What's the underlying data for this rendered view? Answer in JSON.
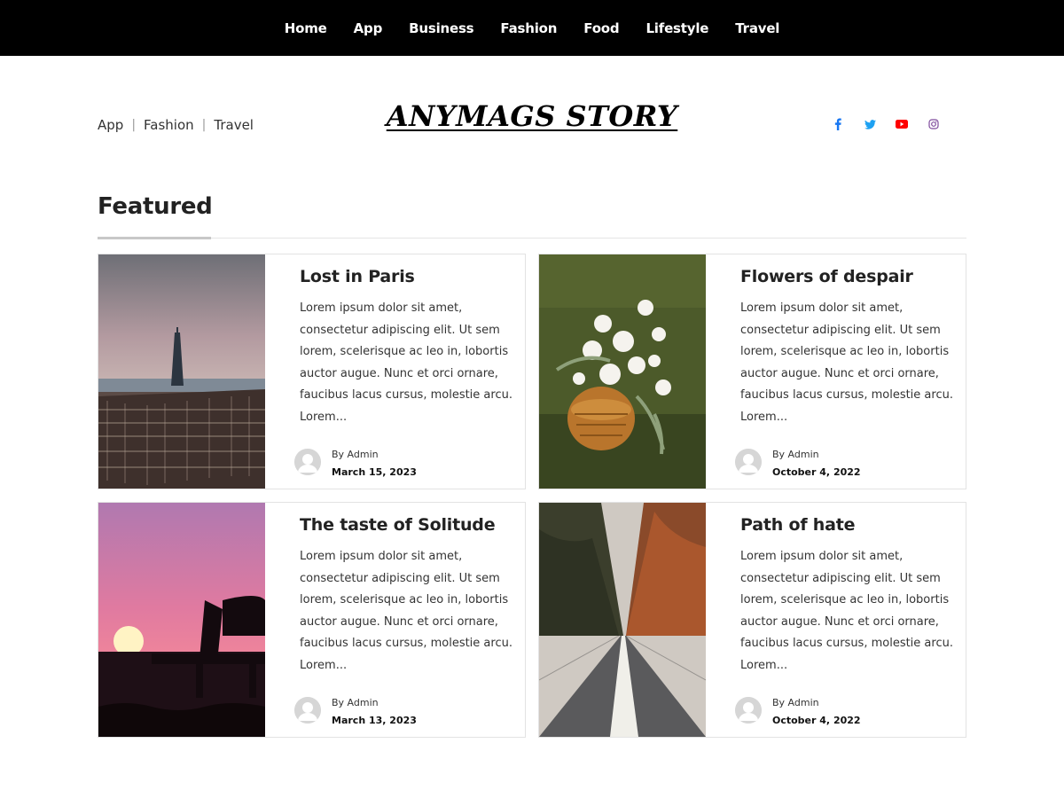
{
  "topnav": {
    "items": [
      "Home",
      "App",
      "Business",
      "Fashion",
      "Food",
      "Lifestyle",
      "Travel"
    ]
  },
  "header": {
    "categories": [
      "App",
      "Fashion",
      "Travel"
    ],
    "logo": "ANYMAGS STORY",
    "social_icons": [
      {
        "name": "facebook-icon",
        "color": "#1877f2"
      },
      {
        "name": "twitter-icon",
        "color": "#1da1f2"
      },
      {
        "name": "youtube-icon",
        "color": "#ff0000"
      },
      {
        "name": "instagram-icon",
        "color": "#7e4a9c"
      }
    ]
  },
  "section": {
    "title": "Featured"
  },
  "posts": [
    {
      "title": "Lost in Paris",
      "excerpt": "Lorem ipsum dolor sit amet, consectetur adipiscing elit. Ut sem lorem, scelerisque ac leo in, lobortis auctor augue. Nunc et orci ornare, faucibus lacus cursus, molestie arcu. Lorem...",
      "author": "By Admin",
      "date": "March 15, 2023",
      "image": "paris-cityscape"
    },
    {
      "title": "Flowers of despair",
      "excerpt": "Lorem ipsum dolor sit amet, consectetur adipiscing elit. Ut sem lorem, scelerisque ac leo in, lobortis auctor augue. Nunc et orci ornare, faucibus lacus cursus, molestie arcu. Lorem...",
      "author": "By Admin",
      "date": "October 4, 2022",
      "image": "flower-basket"
    },
    {
      "title": "The taste of Solitude",
      "excerpt": "Lorem ipsum dolor sit amet, consectetur adipiscing elit. Ut sem lorem, scelerisque ac leo in, lobortis auctor augue. Nunc et orci ornare, faucibus lacus cursus, molestie arcu. Lorem...",
      "author": "By Admin",
      "date": "March 13, 2023",
      "image": "sunset-bench"
    },
    {
      "title": "Path of hate",
      "excerpt": "Lorem ipsum dolor sit amet, consectetur adipiscing elit. Ut sem lorem, scelerisque ac leo in, lobortis auctor augue. Nunc et orci ornare, faucibus lacus cursus, molestie arcu. Lorem...",
      "author": "By Admin",
      "date": "October 4, 2022",
      "image": "forest-road"
    }
  ]
}
